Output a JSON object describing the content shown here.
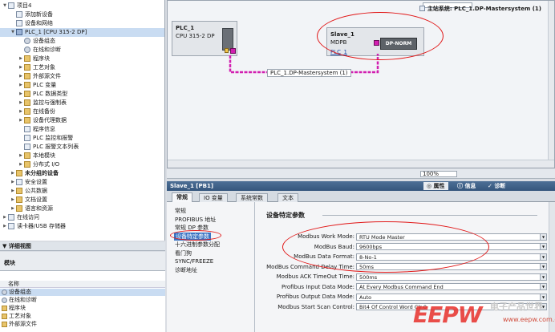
{
  "tree": {
    "items": [
      {
        "label": "项目4",
        "depth": 0,
        "icon": "project-icon",
        "expand": "▼"
      },
      {
        "label": "添加新设备",
        "depth": 1,
        "icon": "add-device-icon",
        "expand": ""
      },
      {
        "label": "设备和网络",
        "depth": 1,
        "icon": "network-icon",
        "expand": ""
      },
      {
        "label": "PLC_1 [CPU 315-2 DP]",
        "depth": 1,
        "icon": "cpu-icon",
        "expand": "▼",
        "selected": true
      },
      {
        "label": "设备组态",
        "depth": 2,
        "icon": "device-config-icon",
        "expand": ""
      },
      {
        "label": "在线和诊断",
        "depth": 2,
        "icon": "online-diag-icon",
        "expand": ""
      },
      {
        "label": "程序块",
        "depth": 2,
        "icon": "folder-icon",
        "expand": "▶"
      },
      {
        "label": "工艺对象",
        "depth": 2,
        "icon": "folder-icon",
        "expand": "▶"
      },
      {
        "label": "外部源文件",
        "depth": 2,
        "icon": "folder-icon",
        "expand": "▶"
      },
      {
        "label": "PLC 变量",
        "depth": 2,
        "icon": "folder-icon",
        "expand": "▶"
      },
      {
        "label": "PLC 数据类型",
        "depth": 2,
        "icon": "folder-icon",
        "expand": "▶"
      },
      {
        "label": "监控与强制表",
        "depth": 2,
        "icon": "folder-icon",
        "expand": "▶"
      },
      {
        "label": "在线备份",
        "depth": 2,
        "icon": "folder-icon",
        "expand": "▶"
      },
      {
        "label": "设备代理数据",
        "depth": 2,
        "icon": "folder-icon",
        "expand": "▶"
      },
      {
        "label": "程序信息",
        "depth": 2,
        "icon": "program-info-icon",
        "expand": ""
      },
      {
        "label": "PLC 监控和报警",
        "depth": 2,
        "icon": "alarm-icon",
        "expand": ""
      },
      {
        "label": "PLC 报警文本列表",
        "depth": 2,
        "icon": "text-list-icon",
        "expand": ""
      },
      {
        "label": "本地模块",
        "depth": 2,
        "icon": "folder-icon",
        "expand": "▶"
      },
      {
        "label": "分布式 I/O",
        "depth": 2,
        "icon": "folder-icon",
        "expand": "▶"
      },
      {
        "label": "未分组的设备",
        "depth": 1,
        "icon": "folder-icon",
        "expand": "▶",
        "bold": true
      },
      {
        "label": "安全设置",
        "depth": 1,
        "icon": "security-icon",
        "expand": "▶"
      },
      {
        "label": "公共数据",
        "depth": 1,
        "icon": "folder-icon",
        "expand": "▶"
      },
      {
        "label": "文档设置",
        "depth": 1,
        "icon": "folder-icon",
        "expand": "▶"
      },
      {
        "label": "语言和资源",
        "depth": 1,
        "icon": "folder-icon",
        "expand": "▶"
      },
      {
        "label": "在线访问",
        "depth": 0,
        "icon": "online-access-icon",
        "expand": "▶"
      },
      {
        "label": "读卡器/USB 存储器",
        "depth": 0,
        "icon": "card-reader-icon",
        "expand": "▶"
      }
    ]
  },
  "details": {
    "title": "详细视图",
    "tab": "模块",
    "column": "名称",
    "rows": [
      "设备组态",
      "在线和诊断",
      "程序块",
      "工艺对象",
      "外部源文件"
    ]
  },
  "network": {
    "master_system": "主站系统: PLC_1.DP-Mastersystem (1)",
    "zoom": "100%",
    "plc": {
      "name": "PLC_1",
      "type": "CPU 315-2 DP"
    },
    "slave": {
      "name": "Slave_1",
      "type": "MDPB",
      "link": "PLC_1",
      "module": "DP-NORM"
    },
    "dp_label": "PLC_1.DP-Mastersystem (1)",
    "line_color": "#d21fb0"
  },
  "inspector": {
    "title": "Slave_1 [PB1]",
    "right_tabs": [
      "属性",
      "信息",
      "诊断"
    ],
    "tabs": [
      "常规",
      "IO 变量",
      "系统常数",
      "文本"
    ],
    "active_tab": 0,
    "nav": [
      "常规",
      "PROFIBUS 地址",
      "常规 DP 参数",
      "设备特定参数",
      "十六进制参数分配",
      "看门狗",
      "SYNC/FREEZE",
      "诊断地址"
    ],
    "nav_selected": 3,
    "section": "设备特定参数",
    "params": [
      {
        "label": "Modbus Work Mode:",
        "value": "RTU Mode Master"
      },
      {
        "label": "ModBus Baud:",
        "value": "9600bps"
      },
      {
        "label": "ModBus Data Format:",
        "value": "8-No-1"
      },
      {
        "label": "ModBus Command Delay Time:",
        "value": "50ms"
      },
      {
        "label": "Modbus ACK TimeOut Time:",
        "value": "500ms"
      },
      {
        "label": "Profibus Input Data Mode:",
        "value": "At Every Modbus Command End"
      },
      {
        "label": "Profibus Output Data Mode:",
        "value": "Auto"
      },
      {
        "label": "Modbus Start Scan Control:",
        "value": "Bit4 Of Control Word Clr 0"
      }
    ]
  },
  "watermark": {
    "logo": "EEPW",
    "cn": "电子产品世界",
    "url": "www.eepw.com.cn"
  },
  "colors": {
    "highlight_ellipse": "#e11818",
    "title_bar": "#35567d",
    "selection": "#3b74c4"
  }
}
